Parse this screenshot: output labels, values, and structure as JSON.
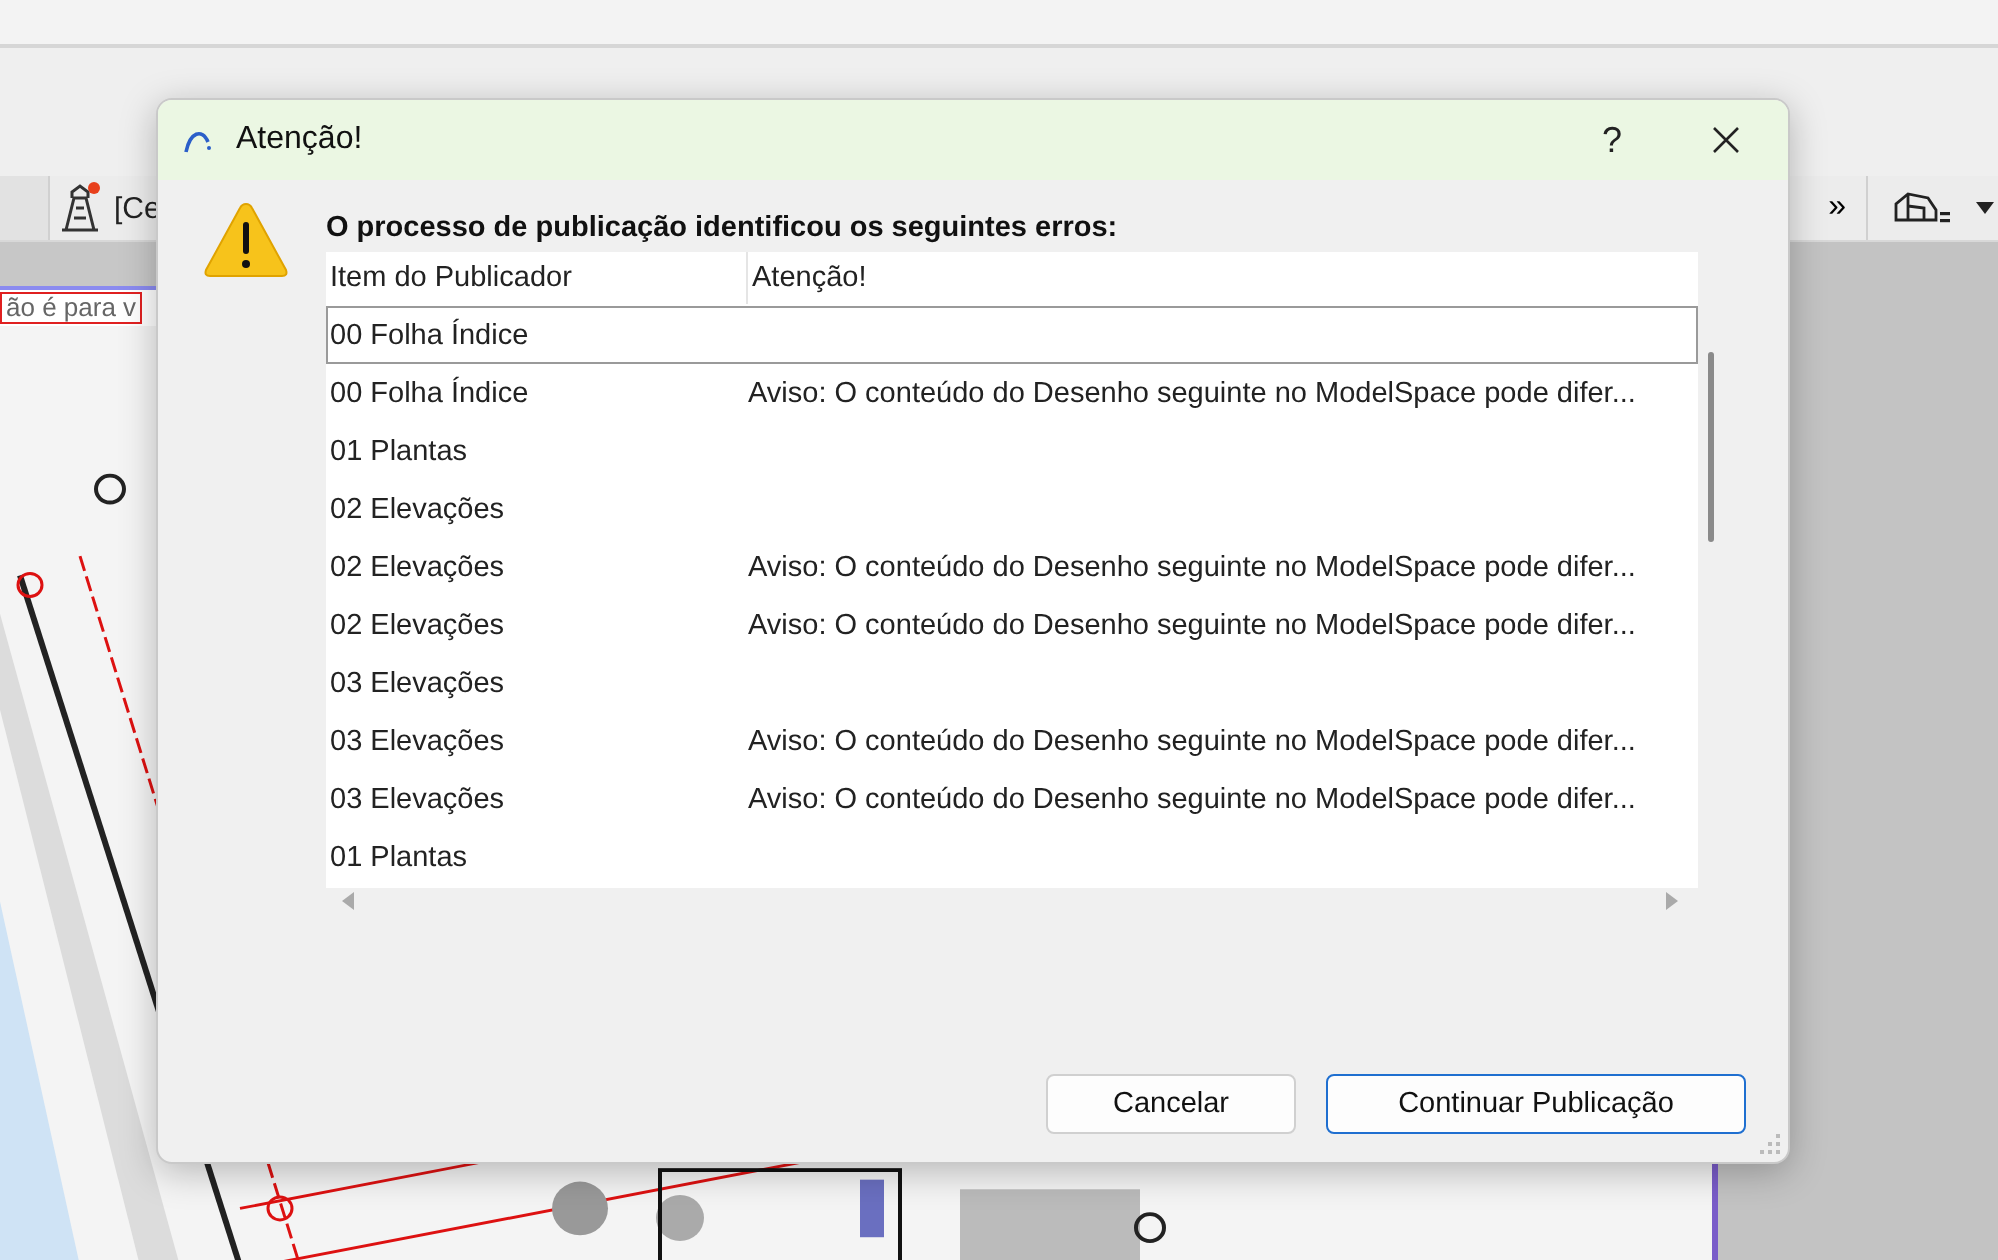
{
  "app": {
    "toolbar": {
      "tab_label": "[Ce",
      "overflow": "»"
    },
    "drawing_note": "ão é para v"
  },
  "dialog": {
    "title": "Atenção!",
    "help": "?",
    "heading": "O processo de publicação identificou os seguintes erros:",
    "table": {
      "columns": [
        "Item do Publicador",
        "Atenção!"
      ],
      "rows": [
        {
          "cells": [
            "00 Folha Índice",
            ""
          ],
          "selected": true
        },
        {
          "cells": [
            "00 Folha Índice",
            "Aviso: O conteúdo do Desenho seguinte no ModelSpace pode difer..."
          ],
          "selected": false
        },
        {
          "cells": [
            "01 Plantas",
            ""
          ],
          "selected": false
        },
        {
          "cells": [
            "02 Elevações",
            ""
          ],
          "selected": false
        },
        {
          "cells": [
            "02 Elevações",
            "Aviso: O conteúdo do Desenho seguinte no ModelSpace pode difer..."
          ],
          "selected": false
        },
        {
          "cells": [
            "02 Elevações",
            "Aviso: O conteúdo do Desenho seguinte no ModelSpace pode difer..."
          ],
          "selected": false
        },
        {
          "cells": [
            "03 Elevações",
            ""
          ],
          "selected": false
        },
        {
          "cells": [
            "03 Elevações",
            "Aviso: O conteúdo do Desenho seguinte no ModelSpace pode difer..."
          ],
          "selected": false
        },
        {
          "cells": [
            "03 Elevações",
            "Aviso: O conteúdo do Desenho seguinte no ModelSpace pode difer..."
          ],
          "selected": false
        },
        {
          "cells": [
            "01 Plantas",
            ""
          ],
          "selected": false
        }
      ]
    },
    "buttons": [
      {
        "label": "Cancelar",
        "default": false
      },
      {
        "label": "Continuar Publicação",
        "default": true
      }
    ]
  }
}
